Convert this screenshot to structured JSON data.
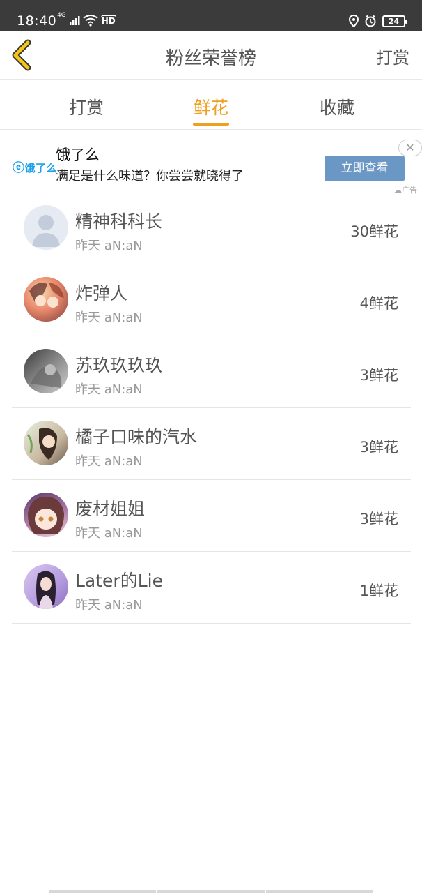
{
  "status_bar": {
    "time": "18:40",
    "network": "4G",
    "hd": "HD",
    "battery": "24"
  },
  "nav": {
    "title": "粉丝荣誉榜",
    "action": "打赏"
  },
  "tabs": [
    {
      "label": "打赏",
      "active": false
    },
    {
      "label": "鲜花",
      "active": true
    },
    {
      "label": "收藏",
      "active": false
    }
  ],
  "ad": {
    "logo": "饿了么",
    "title": "饿了么",
    "description": "满足是什么味道？你尝尝就晓得了",
    "button": "立即查看",
    "tag": "广告"
  },
  "fans": [
    {
      "name": "精神科科长",
      "time": "昨天 aN:aN",
      "count": "30鲜花"
    },
    {
      "name": "炸弹人",
      "time": "昨天 aN:aN",
      "count": "4鲜花"
    },
    {
      "name": "苏玖玖玖玖",
      "time": "昨天 aN:aN",
      "count": "3鲜花"
    },
    {
      "name": "橘子口味的汽水",
      "time": "昨天 aN:aN",
      "count": "3鲜花"
    },
    {
      "name": "废材姐姐",
      "time": "昨天 aN:aN",
      "count": "3鲜花"
    },
    {
      "name": "Later的Lie",
      "time": "昨天 aN:aN",
      "count": "1鲜花"
    }
  ],
  "colors": {
    "accent": "#f0a020",
    "ad_button": "#6b97c4",
    "status_bar": "#3b3b3b"
  }
}
